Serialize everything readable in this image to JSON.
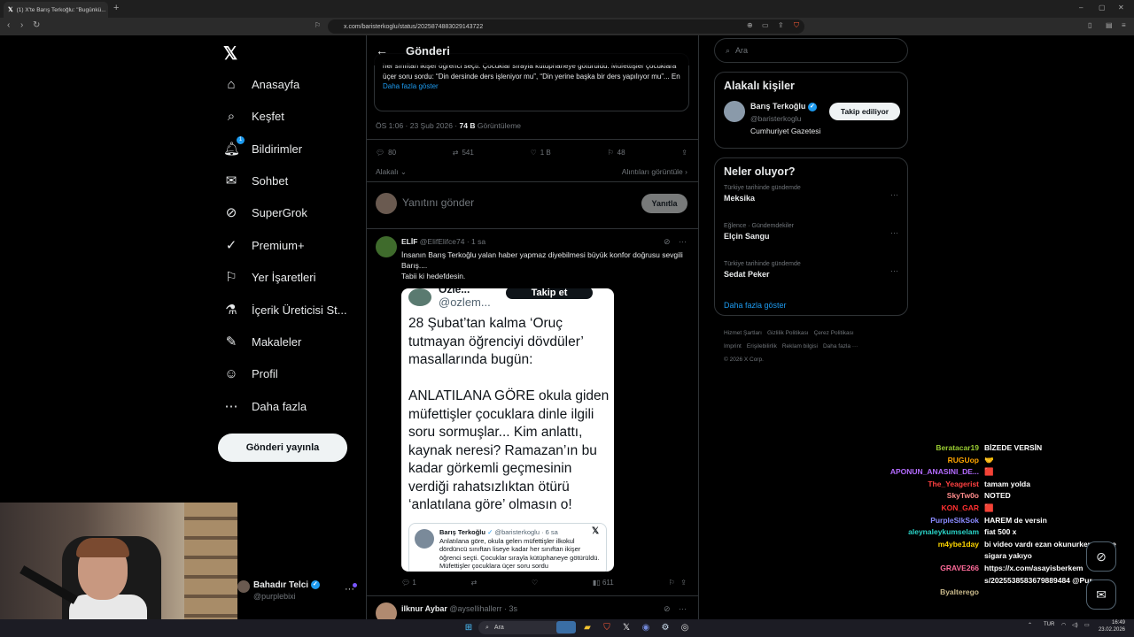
{
  "browser": {
    "tab_title": "(1) X'te Barış Terkoğlu: \"Bugünkü...",
    "url": "x.com/baristerkoglu/status/2025874883029143722",
    "new_tab": "+"
  },
  "nav": {
    "items": [
      {
        "label": "Anasayfa",
        "icon": "home-icon",
        "glyph": "⌂"
      },
      {
        "label": "Keşfet",
        "icon": "search-icon",
        "glyph": "⌕"
      },
      {
        "label": "Bildirimler",
        "icon": "bell-icon",
        "glyph": "🔔︎",
        "badge": "1"
      },
      {
        "label": "Sohbet",
        "icon": "mail-icon",
        "glyph": "✉"
      },
      {
        "label": "SuperGrok",
        "icon": "grok-icon",
        "glyph": "⊘"
      },
      {
        "label": "Premium+",
        "icon": "verified-icon",
        "glyph": "✓"
      },
      {
        "label": "Yer İşaretleri",
        "icon": "bookmark-icon",
        "glyph": "⚐"
      },
      {
        "label": "İçerik Üreticisi St...",
        "icon": "flask-icon",
        "glyph": "⚗"
      },
      {
        "label": "Makaleler",
        "icon": "article-icon",
        "glyph": "✎"
      },
      {
        "label": "Profil",
        "icon": "person-icon",
        "glyph": "☺"
      },
      {
        "label": "Daha fazla",
        "icon": "more-circle-icon",
        "glyph": "⋯"
      }
    ],
    "post_button": "Gönderi yayınla",
    "account": {
      "name": "Bahadır Telci",
      "handle": "@purplebixi"
    }
  },
  "header": {
    "title": "Gönderi"
  },
  "quoted_tweet": {
    "text": "her sınıftan ikişer öğrenci seçti. Çocuklar sırayla kütüphaneye götürüldü. Müfettişler çocuklara üçer soru sordu: “Din dersinde ders işleniyor mu”, “Din yerine başka bir ders yapılıyor mu”... En",
    "more": "Daha fazla göster"
  },
  "meta": {
    "time": "ÖS 1:06 · 23 Şub 2026 ·",
    "views": "74 B",
    "views_label": "Görüntüleme"
  },
  "stats": {
    "replies": "80",
    "retweets": "541",
    "likes": "1 B",
    "bookmarks": "48"
  },
  "links": {
    "relevant": "Alakalı",
    "quotes": "Alıntıları görüntüle"
  },
  "reply_box": {
    "placeholder": "Yanıtını gönder",
    "button": "Yanıtla"
  },
  "reply_tweet": {
    "name": "ELİF",
    "handle": "@ElifElifce74",
    "time": "· 1 sa",
    "text1": "İnsanın Barış Terkoğlu yalan haber yapmaz diyebilmesi büyük konfor doğrusu sevgili Barış....",
    "text2": "Tabii ki hedefdesin.",
    "image": {
      "name": "Özle...",
      "handle": "@ozlem...",
      "follow": "Takip et",
      "text": "28 Şubat’tan kalma ‘Oruç tutmayan öğrenciyi dövdüler’ masallarında bugün:\n\nANLATILANA GÖRE okula giden müfettişler çocuklara dinle ilgili soru sormuşlar... Kim anlattı, kaynak neresi? Ramazan’ın bu kadar görkemli geçmesinin verdiği rahatsızlıktan ötürü ‘anlatılana göre’ olmasın o!",
      "inner_name": "Barış Terkoğlu",
      "inner_handle": "@baristerkoglu · 6 sa",
      "inner_text": "Anlatılana göre, okula gelen müfettişler ilkokul dördüncü sınıftan liseye kadar her sınıftan ikişer öğrenci seçti. Çocuklar sırayla kütüphaneye götürüldü. Müfettişler çocuklara üçer soru sordu"
    },
    "stats": {
      "replies": "1",
      "views": "611"
    }
  },
  "next_tweet": {
    "name": "ilknur Aybar",
    "handle": "@aysellihallerr",
    "time": "· 3s"
  },
  "sidebar": {
    "search_placeholder": "Ara",
    "relevant_title": "Alakalı kişiler",
    "person": {
      "name": "Barış Terkoğlu",
      "handle": "@baristerkoglu",
      "bio": "Cumhuriyet Gazetesi",
      "button": "Takip ediliyor"
    },
    "trends_title": "Neler oluyor?",
    "trends": [
      {
        "context": "Türkiye tarihinde gündemde",
        "name": "Meksika"
      },
      {
        "context": "Eğlence · Gündemdekiler",
        "name": "Elçin Sangu"
      },
      {
        "context": "Türkiye tarihinde gündemde",
        "name": "Sedat Peker"
      }
    ],
    "show_more": "Daha fazla göster",
    "footer": [
      "Hizmet Şartları",
      "Gizlilik Politikası",
      "Çerez Politikası",
      "Imprint",
      "Erişilebilirlik",
      "Reklam bilgisi",
      "Daha fazla ···",
      "© 2026 X Corp."
    ]
  },
  "chat": [
    {
      "user": "Beratacar19",
      "msg": "BİZEDE VERSİN",
      "color": "#9acd32"
    },
    {
      "user": "RUGUop",
      "msg": "🤝",
      "color": "#ffa500"
    },
    {
      "user": "APONUN_ANASINI_DE...",
      "msg": "🟥",
      "color": "#b36bff"
    },
    {
      "user": "The_Yeagerist",
      "msg": "tamam yolda",
      "color": "#ff4040"
    },
    {
      "user": "SkyTw0o",
      "msg": "NOTED",
      "color": "#ff8c8c"
    },
    {
      "user": "KON_GAR",
      "msg": "🟥",
      "color": "#ff3030"
    },
    {
      "user": "PurpleSlkSok",
      "msg": "HAREM de versin",
      "color": "#8a8aff"
    },
    {
      "user": "aleynaleykumselam",
      "msg": "fiat 500 x",
      "color": "#2ad4c8"
    },
    {
      "user": "m4ybe1day",
      "msg": "bi video vardı ezan okunurken 5 tane",
      "color": "#ffd700"
    },
    {
      "user": "",
      "msg": "sigara yakıyo",
      "color": "#fff"
    },
    {
      "user": "GRAVE266",
      "msg": "https://x.com/asayisberkem",
      "color": "#ff6b9a"
    },
    {
      "user": "",
      "msg": "s/2025538583679889484 @Pur",
      "color": "#fff"
    },
    {
      "user": "",
      "msg": "",
      "color": "#fff"
    },
    {
      "user": "Byalterego",
      "msg": "",
      "color": "#c8b88a"
    }
  ],
  "taskbar": {
    "search": "Ara",
    "lang": "TUR",
    "time": "16:49",
    "date": "23.02.2026"
  }
}
